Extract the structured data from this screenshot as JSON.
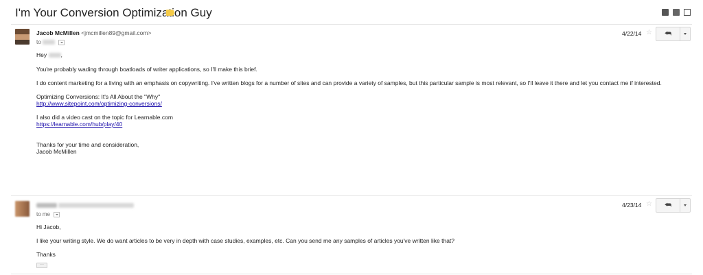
{
  "subject": "I'm Your Conversion Optimization Guy",
  "messages": [
    {
      "sender_name": "Jacob McMillen",
      "sender_email": "<jmcmillen89@gmail.com>",
      "to_prefix": "to",
      "date": "4/22/14",
      "greeting": "Hey",
      "greeting_end": ",",
      "paragraphs": [
        "You're probably wading through boatloads of writer applications, so I'll make this brief.",
        "I do content marketing for a living with an emphasis on copywriting. I've written blogs for a number of sites and can provide a variety of samples, but this particular sample is most relevant, so I'll leave it there and let you contact me if interested.",
        "Optimizing Conversions: It's All About the \"Why\"",
        "http://www.sitepoint.com/optimizing-conversions/",
        "I also did a video cast on the topic for Learnable.com",
        "https://learnable.com/hub/play/40",
        "Thanks for your time and consideration,",
        "Jacob McMillen"
      ]
    },
    {
      "to_prefix": "to me",
      "date": "4/23/14",
      "paragraphs": [
        "Hi Jacob,",
        "I like your writing style. We do want articles to be very in depth with case studies, examples, etc. Can you send me any samples of articles you've written like that?",
        "Thanks"
      ],
      "ellipsis": "···"
    }
  ],
  "icons": {
    "star": "☆",
    "reply": "⮪"
  }
}
